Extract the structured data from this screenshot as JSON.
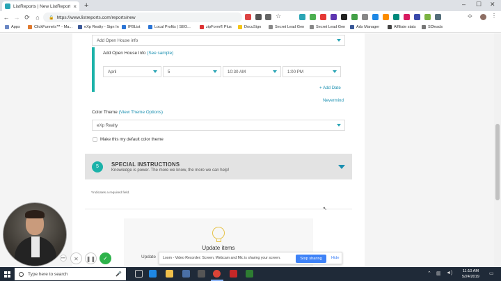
{
  "browser": {
    "tab_title": "ListReports | New ListReport",
    "tab_close": "×",
    "new_tab": "+",
    "url": "https://www.listreports.com/reports/new",
    "min": "–",
    "max": "☐",
    "close": "✕",
    "accent": "#2aa5b5"
  },
  "bookmarks": [
    {
      "label": "Apps",
      "color": "#6b88c4"
    },
    {
      "label": "ClickFunnels™ - Ma...",
      "color": "#e07a2f"
    },
    {
      "label": "eXp Realty - Sign In",
      "color": "#3d5a99"
    },
    {
      "label": "IFBList",
      "color": "#2b75d5"
    },
    {
      "label": "Local Profits | SEO...",
      "color": "#2b75d5"
    },
    {
      "label": "zipForm® Plus",
      "color": "#d33"
    },
    {
      "label": "DocuSign",
      "color": "#f5c518"
    },
    {
      "label": "Secret Lead Gen",
      "color": "#888"
    },
    {
      "label": "Secret Lead Gen",
      "color": "#888"
    },
    {
      "label": "Ads Manager",
      "color": "#3b5998"
    },
    {
      "label": "Affiliate stats",
      "color": "#444"
    },
    {
      "label": "SDleads",
      "color": "#777"
    }
  ],
  "form": {
    "top_select": "Add Open House info",
    "open_house_label": "Add Open House Info",
    "see_sample": "(See sample)",
    "month": "April",
    "day": "5",
    "start_time": "10:30 AM",
    "end_time": "1:00 PM",
    "add_date": "+ Add Date",
    "nevermind": "Nevermind",
    "color_theme_label": "Color Theme",
    "view_theme": "(View Theme Options)",
    "color_theme_value": "eXp Realty",
    "default_theme_checkbox": "Make this my default color theme",
    "special_number": "5",
    "special_title": "SPECIAL INSTRUCTIONS",
    "special_subtitle": "Knowledge is power. The more we know, the more we can help!",
    "required_note": "*Indicates a required field.",
    "update_title": "Update items"
  },
  "recorder": {
    "close": "✕",
    "pause": "❚❚",
    "done": "✓",
    "more": "•••"
  },
  "sharing": {
    "behind_text": "Update",
    "message": "Loom - Video Recorder: Screen, Webcam and Mic is sharing your screen.",
    "stop": "Stop sharing",
    "hide": "Hide"
  },
  "taskbar": {
    "search_placeholder": "Type here to search",
    "time": "11:10 AM",
    "date": "5/24/2019"
  }
}
